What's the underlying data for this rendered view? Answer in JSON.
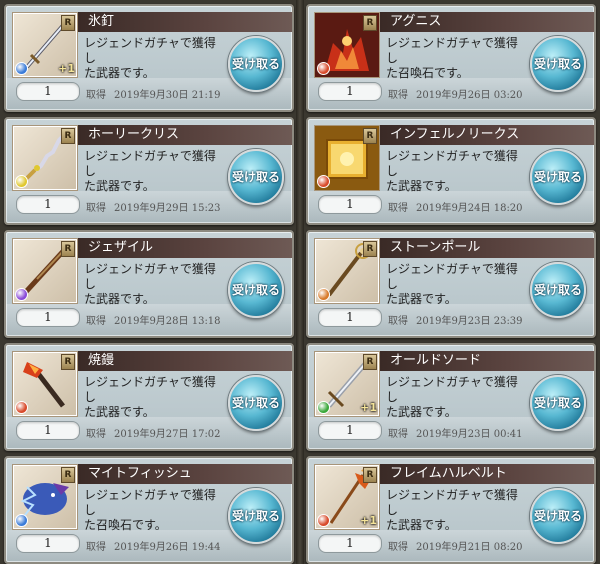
{
  "button_label": "受け取る",
  "acquired_label": "取得",
  "rarity_label": "R",
  "left_column": [
    {
      "name": "氷釘",
      "desc": [
        "レジェンドガチャで獲得し",
        "た武器です。"
      ],
      "qty": "1",
      "date": "2019年9月30日 21:19",
      "element_color": "#3a7bd8",
      "plus": "+1",
      "icon": "weapon-dagger-icon"
    },
    {
      "name": "ホーリークリス",
      "desc": [
        "レジェンドガチャで獲得し",
        "た武器です。"
      ],
      "qty": "1",
      "date": "2019年9月29日 15:23",
      "element_color": "#e0c830",
      "plus": "",
      "icon": "weapon-kris-icon"
    },
    {
      "name": "ジェザイル",
      "desc": [
        "レジェンドガチャで獲得し",
        "た武器です。"
      ],
      "qty": "1",
      "date": "2019年9月28日 13:18",
      "element_color": "#8a4ad8",
      "plus": "",
      "icon": "weapon-rifle-icon"
    },
    {
      "name": "焼鏝",
      "desc": [
        "レジェンドガチャで獲得し",
        "た武器です。"
      ],
      "qty": "1",
      "date": "2019年9月27日 17:02",
      "element_color": "#d84a2a",
      "plus": "",
      "icon": "weapon-brand-iron-icon"
    },
    {
      "name": "マイトフィッシュ",
      "desc": [
        "レジェンドガチャで獲得し",
        "た召喚石です。"
      ],
      "qty": "1",
      "date": "2019年9月26日 19:44",
      "element_color": "#3a7bd8",
      "plus": "",
      "icon": "summon-fish-icon"
    }
  ],
  "right_column": [
    {
      "name": "アグニス",
      "desc": [
        "レジェンドガチャで獲得し",
        "た召喚石です。"
      ],
      "qty": "1",
      "date": "2019年9月26日 03:20",
      "element_color": "#d84a2a",
      "plus": "",
      "icon": "summon-agni-icon"
    },
    {
      "name": "インフェルノリークス",
      "desc": [
        "レジェンドガチャで獲得し",
        "た武器です。"
      ],
      "qty": "1",
      "date": "2019年9月24日 18:20",
      "element_color": "#d84a2a",
      "plus": "",
      "icon": "weapon-tome-icon"
    },
    {
      "name": "ストーンポール",
      "desc": [
        "レジェンドガチャで獲得し",
        "た武器です。"
      ],
      "qty": "1",
      "date": "2019年9月23日 23:39",
      "element_color": "#d87a2a",
      "plus": "",
      "icon": "weapon-staff-icon"
    },
    {
      "name": "オールドソード",
      "desc": [
        "レジェンドガチャで獲得し",
        "た武器です。"
      ],
      "qty": "1",
      "date": "2019年9月23日 00:41",
      "element_color": "#3aa83a",
      "plus": "+1",
      "icon": "weapon-sword-icon"
    },
    {
      "name": "フレイムハルベルト",
      "desc": [
        "レジェンドガチャで獲得し",
        "た武器です。"
      ],
      "qty": "1",
      "date": "2019年9月21日 08:20",
      "element_color": "#d84a2a",
      "plus": "+1",
      "icon": "weapon-halberd-icon"
    }
  ]
}
